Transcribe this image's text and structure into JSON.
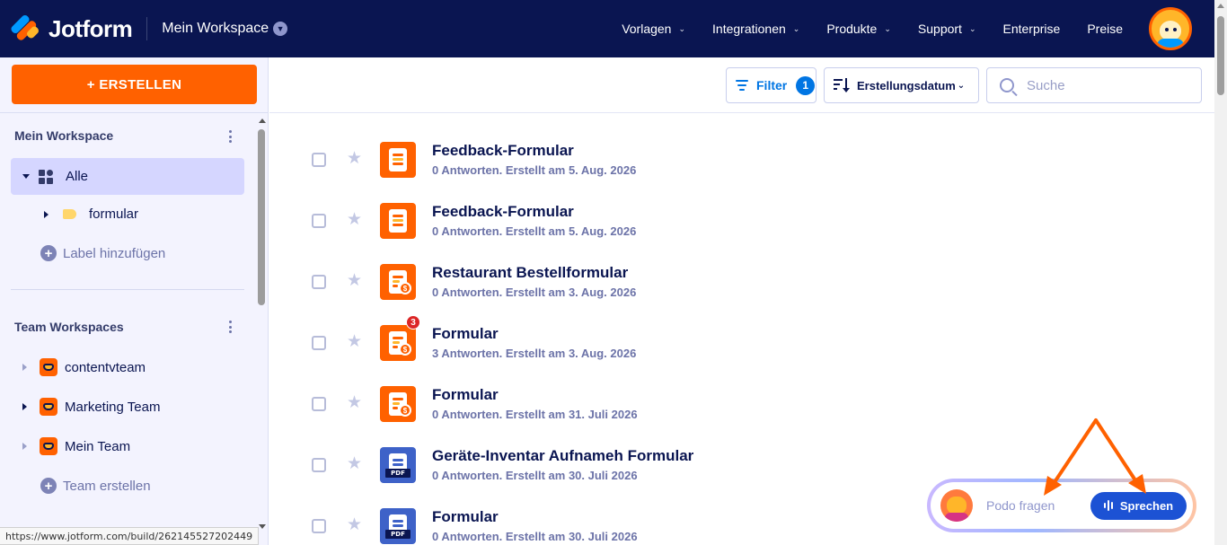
{
  "header": {
    "logo_text": "Jotform",
    "workspace": "Mein Workspace",
    "nav": [
      {
        "label": "Vorlagen",
        "has_caret": true
      },
      {
        "label": "Integrationen",
        "has_caret": true
      },
      {
        "label": "Produkte",
        "has_caret": true
      },
      {
        "label": "Support",
        "has_caret": true
      },
      {
        "label": "Enterprise",
        "has_caret": false
      },
      {
        "label": "Preise",
        "has_caret": false
      }
    ]
  },
  "sidebar": {
    "create_label": "+ ERSTELLEN",
    "my_workspace_title": "Mein Workspace",
    "all_label": "Alle",
    "folder_label": "formular",
    "add_label": "Label hinzufügen",
    "team_title": "Team Workspaces",
    "teams": [
      {
        "label": "contentvteam"
      },
      {
        "label": "Marketing Team"
      },
      {
        "label": "Mein Team"
      }
    ],
    "create_team": "Team erstellen"
  },
  "status_url": "https://www.jotform.com/build/262145527202449",
  "toolbar": {
    "filter_label": "Filter",
    "filter_count": "1",
    "sort_label": "Erstellungsdatum",
    "search_placeholder": "Suche"
  },
  "forms": [
    {
      "title": "Feedback-Formular",
      "meta": "0 Antworten. Erstellt am 5. Aug. 2026",
      "icon": "form"
    },
    {
      "title": "Feedback-Formular",
      "meta": "0 Antworten. Erstellt am 5. Aug. 2026",
      "icon": "form"
    },
    {
      "title": "Restaurant Bestellformular",
      "meta": "0 Antworten. Erstellt am 3. Aug. 2026",
      "icon": "payment"
    },
    {
      "title": "Formular",
      "meta": "3 Antworten. Erstellt am 3. Aug. 2026",
      "icon": "payment",
      "badge": "3"
    },
    {
      "title": "Formular",
      "meta": "0 Antworten. Erstellt am 31. Juli 2026",
      "icon": "payment"
    },
    {
      "title": "Geräte-Inventar Aufnameh Formular",
      "meta": "0 Antworten. Erstellt am 30. Juli 2026",
      "icon": "pdf"
    },
    {
      "title": "Formular",
      "meta": "0 Antworten. Erstellt am 30. Juli 2026",
      "icon": "pdf"
    }
  ],
  "podo": {
    "ask_label": "Podo fragen",
    "speak_label": "Sprechen"
  },
  "colors": {
    "header_bg": "#0a1551",
    "brand_orange": "#ff6100",
    "accent_blue": "#0075e3",
    "pdf_blue": "#3e62c8",
    "annotation_arrow": "#ff6100"
  }
}
